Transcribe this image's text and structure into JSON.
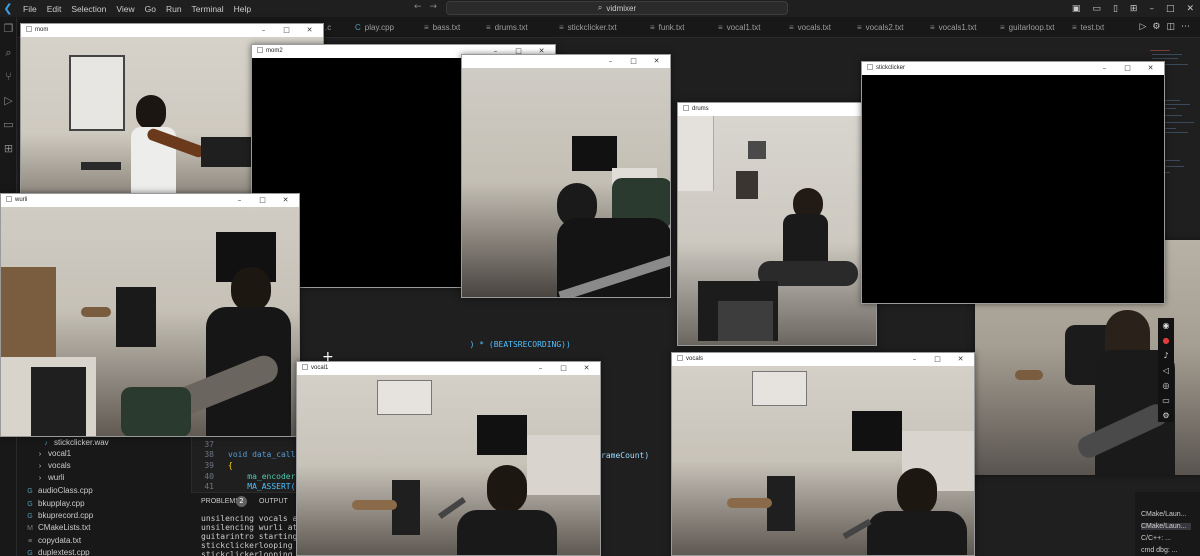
{
  "titlebar": {
    "menu": [
      "File",
      "Edit",
      "Selection",
      "View",
      "Go",
      "Run",
      "Terminal",
      "Help"
    ],
    "search_text": "vidmixer"
  },
  "tabs": [
    {
      "label": ".c",
      "icon": "cpp-icon"
    },
    {
      "label": "play.cpp",
      "icon": "cpp-icon"
    },
    {
      "label": "bass.txt",
      "icon": "txt-icon"
    },
    {
      "label": "drums.txt",
      "icon": "txt-icon"
    },
    {
      "label": "stickclicker.txt",
      "icon": "txt-icon"
    },
    {
      "label": "funk.txt",
      "icon": "txt-icon"
    },
    {
      "label": "vocal1.txt",
      "icon": "txt-icon"
    },
    {
      "label": "vocals.txt",
      "icon": "txt-icon"
    },
    {
      "label": "vocals2.txt",
      "icon": "txt-icon"
    },
    {
      "label": "vocals1.txt",
      "icon": "txt-icon"
    },
    {
      "label": "guitarloop.txt",
      "icon": "txt-icon"
    },
    {
      "label": "test.txt",
      "icon": "txt-icon"
    }
  ],
  "code_fragments": {
    "beats": ") * (BEATSRECORDING))",
    "framecount": "rameCount)"
  },
  "explorer": {
    "items": [
      {
        "label": "stickclicker.wav",
        "kind": "file"
      },
      {
        "label": "vocal1",
        "kind": "folder"
      },
      {
        "label": "vocals",
        "kind": "folder"
      },
      {
        "label": "wurli",
        "kind": "folder"
      },
      {
        "label": "audioClass.cpp",
        "kind": "file"
      },
      {
        "label": "bkupplay.cpp",
        "kind": "file"
      },
      {
        "label": "bkuprecord.cpp",
        "kind": "file"
      },
      {
        "label": "CMakeLists.txt",
        "kind": "file"
      },
      {
        "label": "copydata.txt",
        "kind": "file"
      },
      {
        "label": "duplextest.cpp",
        "kind": "file"
      }
    ]
  },
  "code": {
    "lines": [
      {
        "num": "37",
        "text": ""
      },
      {
        "num": "38",
        "text": "void data_callb"
      },
      {
        "num": "39",
        "text": "{"
      },
      {
        "num": "40",
        "text": "    ma_encoder*"
      },
      {
        "num": "41",
        "text": "    MA_ASSERT(("
      }
    ]
  },
  "panel": {
    "problems_label": "PROBLEMS",
    "problems_count": "2",
    "output_label": "OUTPUT",
    "lines": [
      "unsilencing vocals at",
      "unsilencing wurli at 0",
      "guitarintro starting n",
      "stickclickerlooping",
      "stickclickerlooping"
    ]
  },
  "terminals": [
    "CMake/Laun...",
    "CMake/Laun...",
    "C/C++: ...",
    "cmd dbg: ..."
  ],
  "windows": {
    "mom": "mom",
    "mom2": "mom2",
    "drums": "drums",
    "stickclicker": "stickclicker",
    "wurli": "wurli",
    "vocal1": "vocal1",
    "vocals": "vocals"
  },
  "colors": {
    "accent": "#3c9ee5",
    "keyword": "#569cd6",
    "function": "#dcdcaa",
    "macro": "#4fc1ff",
    "record": "#e03c3c"
  }
}
